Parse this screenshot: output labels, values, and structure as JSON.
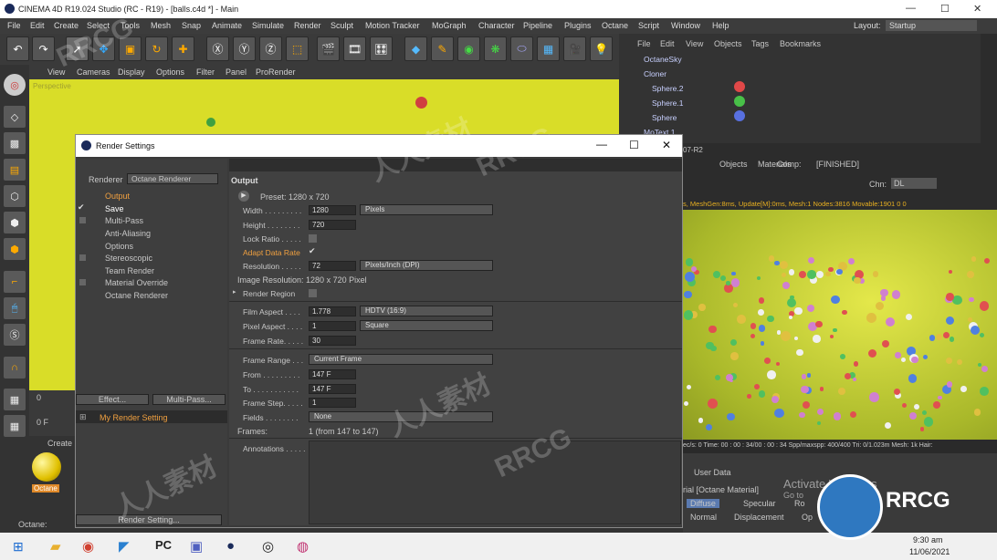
{
  "window": {
    "title": "CINEMA 4D R19.024 Studio (RC - R19) - [balls.c4d *] - Main",
    "min": "—",
    "max": "☐",
    "close": "✕"
  },
  "menubar": {
    "items": [
      "File",
      "Edit",
      "Create",
      "Select",
      "Tools",
      "Mesh",
      "Snap",
      "Animate",
      "Simulate",
      "Render",
      "Sculpt",
      "Motion Tracker",
      "MoGraph",
      "Character",
      "Pipeline",
      "Plugins",
      "Octane",
      "Script",
      "Window",
      "Help"
    ],
    "layout_label": "Layout:",
    "layout_value": "Startup"
  },
  "viewport": {
    "menu": [
      "View",
      "Cameras",
      "Display",
      "Options",
      "Filter",
      "Panel",
      "ProRender"
    ],
    "label": "Perspective"
  },
  "objects": {
    "menu": [
      "File",
      "Edit",
      "View",
      "Objects",
      "Tags",
      "Bookmarks"
    ],
    "items": [
      "OctaneSky",
      "Cloner",
      "Sphere.2",
      "Sphere.1",
      "Sphere",
      "MoText.1"
    ]
  },
  "live": {
    "tabs": [
      "Objects",
      "Materials",
      "Comp:",
      "[FINISHED]"
    ],
    "chn_label": "Chn:",
    "chn_value": "DL",
    "version": "07-R2",
    "status": "s, MeshGen:8ms, Update[M]:0ms, Mesh:1 Nodes:3816 Movable:1901 0 0",
    "bottom": "ec/s: 0     Time: 00 : 00 : 34/00 : 00 : 34  Spp/maxspp: 400/400     Tri: 0/1.023m  Mesh: 1k  Hair:"
  },
  "attr": {
    "user_data": "User Data",
    "mat": "rial [Octane Material]",
    "tabs": [
      "Diffuse",
      "Specular",
      "Ro",
      "Normal",
      "Displacement",
      "Op"
    ],
    "activate": "Activate Windows",
    "goto": "Go to"
  },
  "timeline": {
    "frame": "0 F",
    "zero": "0"
  },
  "materials": {
    "create": "Create",
    "octane": "Octane"
  },
  "statusbar": {
    "text": "Octane:"
  },
  "dialog": {
    "title": "Render Settings",
    "renderer_label": "Renderer",
    "renderer_value": "Octane Renderer",
    "sidebar": [
      "Output",
      "Save",
      "Multi-Pass",
      "Anti-Aliasing",
      "Options",
      "Stereoscopic",
      "Team Render",
      "Material Override",
      "Octane Renderer"
    ],
    "effect_btn": "Effect...",
    "multipass_btn": "Multi-Pass...",
    "setting_name": "My Render Setting",
    "render_setting_btn": "Render Setting...",
    "section": "Output",
    "preset": "Preset: 1280 x 720",
    "width_label": "Width . . . . . . . . .",
    "width": "1280",
    "width_unit": "Pixels",
    "height_label": "Height . . . . . . . .",
    "height": "720",
    "lockratio": "Lock Ratio . . . . .",
    "adr": "Adapt Data Rate",
    "res_label": "Resolution . . . . .",
    "res": "72",
    "res_unit": "Pixels/Inch (DPI)",
    "imgres": "Image Resolution: 1280 x 720 Pixel",
    "region": "Render Region",
    "film_label": "Film Aspect . . . .",
    "film": "1.778",
    "film_unit": "HDTV (16:9)",
    "pixel_label": "Pixel Aspect . . . .",
    "pixel": "1",
    "pixel_unit": "Square",
    "fr_label": "Frame Rate. . . . .",
    "fr": "30",
    "range_label": "Frame Range . . .",
    "range": "Current Frame",
    "from_label": "From . . . . . . . . .",
    "from": "147 F",
    "to_label": "To . . . . . . . . . . .",
    "to": "147 F",
    "step_label": "Frame Step. . . . .",
    "step": "1",
    "fields_label": "Fields . . . . . . . .",
    "fields": "None",
    "frames_label": "Frames:",
    "frames": "1 (from 147 to 147)",
    "annotations": "Annotations . . . . ."
  },
  "taskbar": {
    "time": "9:30 am",
    "date": "11/06/2021"
  },
  "watermarks": [
    "RRCG",
    "人人素材",
    "RRCG",
    "人人素材",
    "RRCG",
    "人人素材"
  ]
}
